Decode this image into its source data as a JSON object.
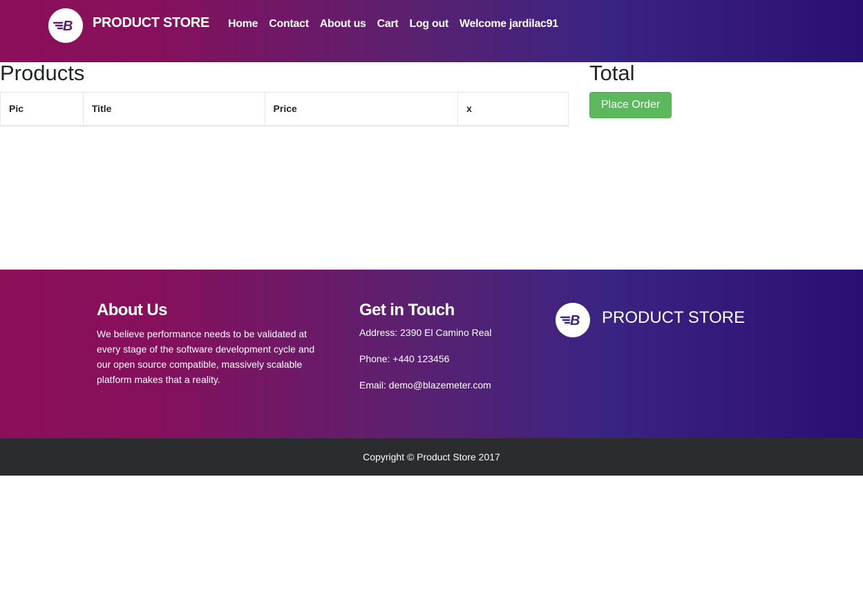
{
  "header": {
    "brand": "PRODUCT STORE",
    "nav": [
      "Home",
      "Contact",
      "About us",
      "Cart",
      "Log out",
      "Welcome jardilac91"
    ]
  },
  "main": {
    "products_title": "Products",
    "total_title": "Total",
    "table_headers": [
      "Pic",
      "Title",
      "Price",
      "x"
    ],
    "place_order": "Place Order"
  },
  "footer": {
    "about_heading": "About Us",
    "about_text": "We believe performance needs to be validated at every stage of the software development cycle and our open source compatible, massively scalable platform makes that a reality.",
    "touch_heading": "Get in Touch",
    "address": "Address: 2390 El Camino Real",
    "phone": "Phone: +440 123456",
    "email": "Email: demo@blazemeter.com",
    "brand": "PRODUCT STORE",
    "copyright": "Copyright © Product Store 2017"
  },
  "colors": {
    "gradient_start": "#8c0f5a",
    "gradient_end": "#2a0f72",
    "button_green": "#5cb85c",
    "footer_bar": "#2b2c2e"
  }
}
